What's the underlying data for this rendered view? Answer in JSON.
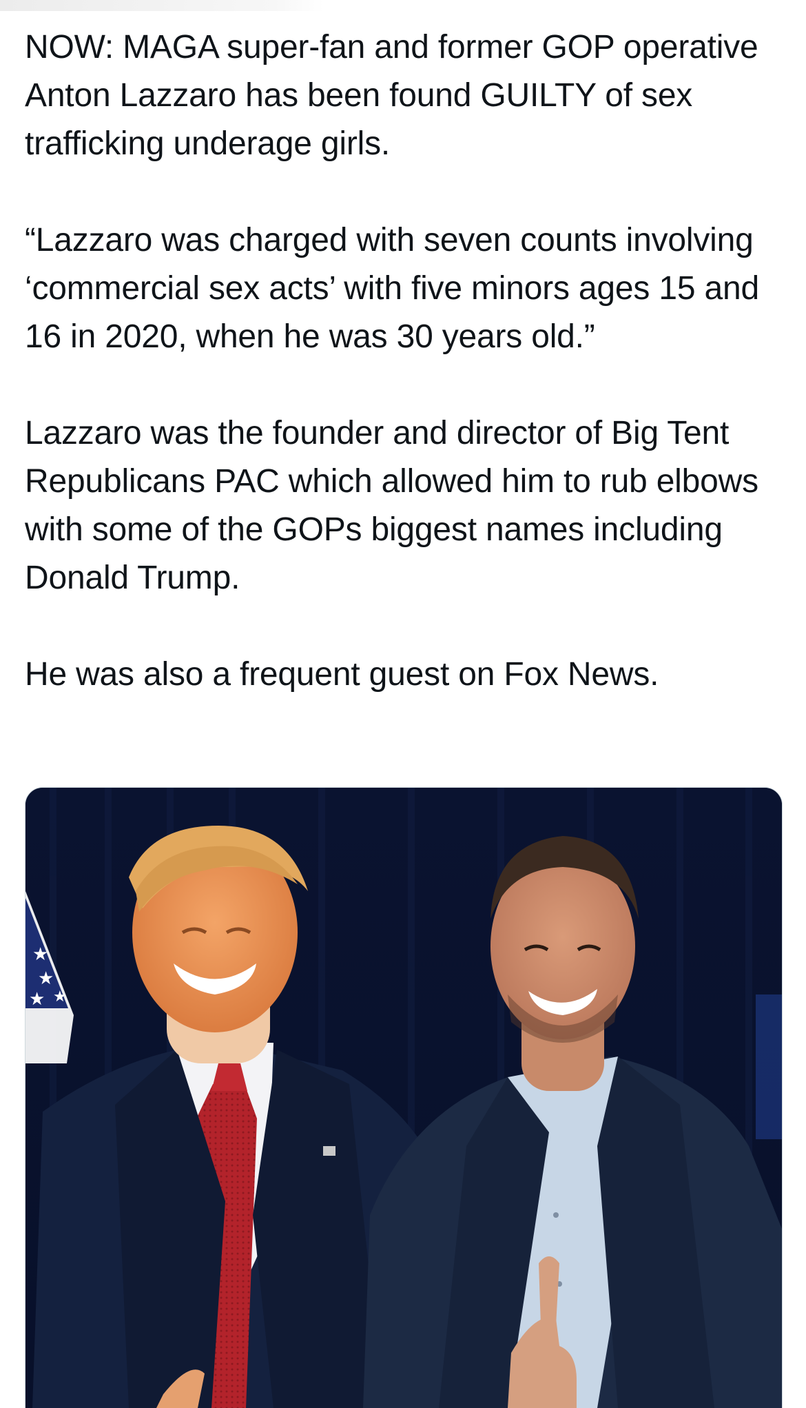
{
  "tweet": {
    "paragraphs": [
      "NOW: MAGA super-fan and former GOP operative Anton Lazzaro has been found GUILTY of sex trafficking underage girls.",
      "“Lazzaro was charged with seven counts involving ‘commercial sex acts’ with five minors ages 15 and 16 in 2020, when he was 30 years old.”",
      "Lazzaro was the founder and director of Big Tent Republicans PAC which allowed him to rub elbows with some of the GOPs biggest names including Donald Trump.",
      "He was also a frequent guest on Fox News."
    ]
  },
  "media": {
    "description_icon": "photo-icon",
    "colors": {
      "backdrop": "#0b1530",
      "suit_left": "#14213f",
      "suit_right": "#1c2a44",
      "tie": "#b3232b",
      "shirt_right": "#c7d6e6"
    }
  }
}
